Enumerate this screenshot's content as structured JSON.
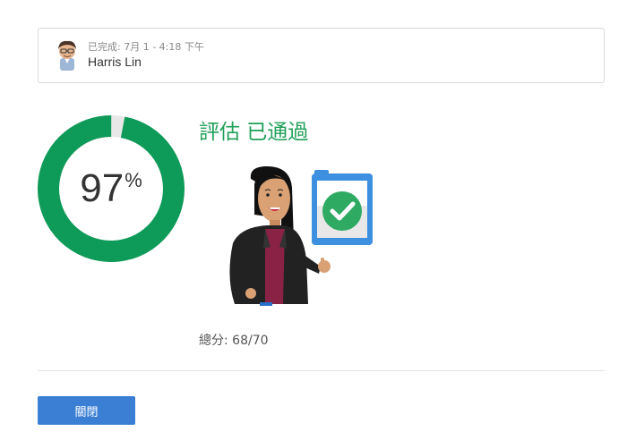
{
  "user": {
    "completed_text": "已完成: 7月 1 - 4:18 下午",
    "name": "Harris Lin",
    "avatar_icon": "user-avatar-icon"
  },
  "score": {
    "percent": 97,
    "percent_label": "97",
    "percent_sign": "%",
    "ring_color": "#0e9a58",
    "ring_track_color": "#e8e8e8"
  },
  "result": {
    "title": "評估 已通過",
    "title_color": "#21a05a",
    "illustration_icon": "passed-illustration-icon",
    "checkmark_icon": "checkmark-icon"
  },
  "total": {
    "text": "總分: 68/70"
  },
  "actions": {
    "close_label": "關閉",
    "close_color": "#3b7fd4"
  }
}
